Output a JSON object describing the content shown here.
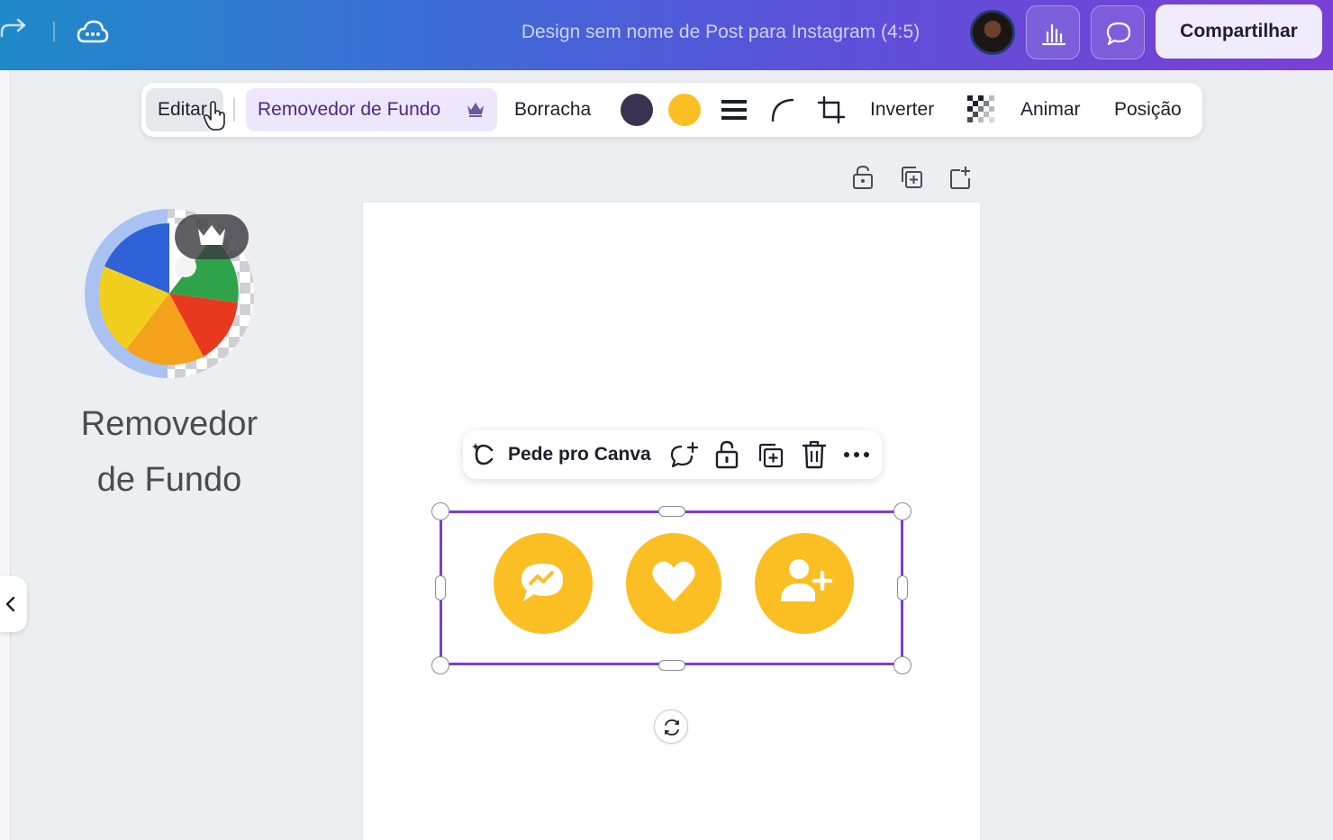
{
  "header": {
    "doc_title": "Design sem nome de Post para Instagram (4:5)",
    "share_label": "Compartilhar",
    "icons": [
      "redo-icon",
      "cloud-sync-icon",
      "analytics-icon",
      "comment-icon"
    ]
  },
  "toolbar": {
    "edit_label": "Editar",
    "bg_remover_label": "Removedor de Fundo",
    "eraser_label": "Borracha",
    "invert_label": "Inverter",
    "animate_label": "Animar",
    "position_label": "Posição",
    "colors": [
      "#3b3150",
      "#fbbf24"
    ]
  },
  "side_panel": {
    "feature_title": "Removedor\nde Fundo"
  },
  "canvas_toolbar": {
    "ask_canva_label": "Pede pro Canva"
  },
  "canvas": {
    "element_icons": [
      "chat-bubble-icon",
      "heart-icon",
      "add-user-icon"
    ],
    "element_color": "#fbbf24",
    "selection_color": "#7d3cd6"
  }
}
